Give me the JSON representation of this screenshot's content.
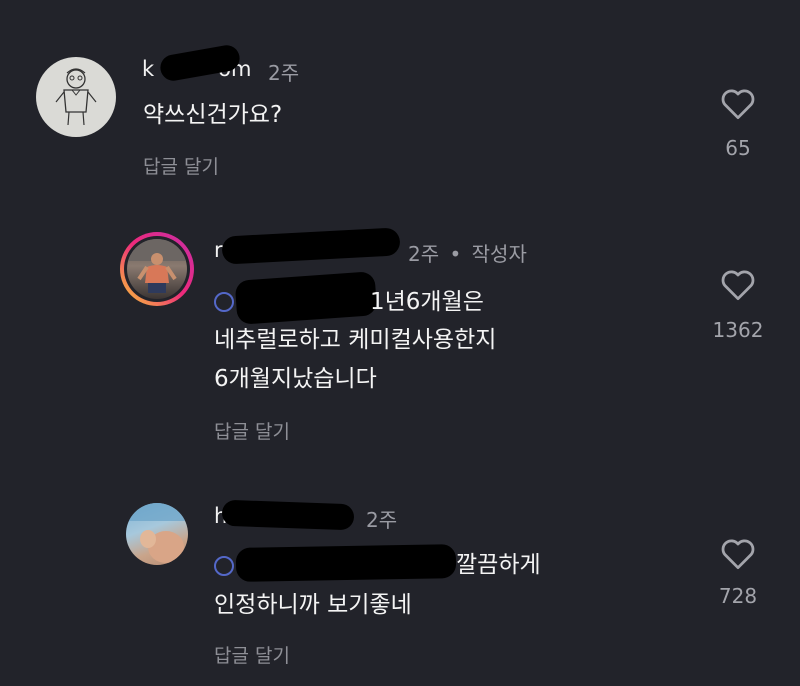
{
  "comments": [
    {
      "username_prefix": "k",
      "username_suffix": "om",
      "time": "2주",
      "text": "약쓰신건가요?",
      "reply_label": "답글 달기",
      "like_icon": "heart-outline-icon",
      "like_count": "65"
    },
    {
      "username_prefix": "r",
      "username_suffix": "",
      "time": "2주",
      "author_badge": "작성자",
      "text_line1_suffix": "1년6개월은",
      "text_line2": "네추럴로하고 케미컬사용한지",
      "text_line3": "6개월지났습니다",
      "reply_label": "답글 달기",
      "like_icon": "heart-outline-icon",
      "like_count": "1362"
    },
    {
      "username_prefix": "h",
      "username_suffix": "",
      "time": "2주",
      "text_line1_suffix": "깔끔하게",
      "text_line2": "인정하니까 보기좋네",
      "reply_label": "답글 달기",
      "like_icon": "heart-outline-icon",
      "like_count": "728"
    }
  ],
  "colors": {
    "background": "#22232a",
    "mention": "#5468c9",
    "muted_text": "#9a9ba3",
    "story_ring_start": "#f9ce34",
    "story_ring_end": "#c62ea8"
  }
}
